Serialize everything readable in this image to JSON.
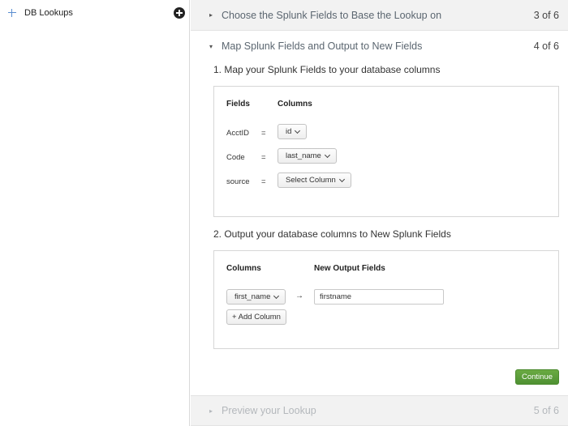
{
  "sidebar": {
    "item_label": "DB Lookups"
  },
  "steps": [
    {
      "title": "Choose the Splunk Fields to Base the Lookup on",
      "count": "3 of 6",
      "caret": "▸"
    },
    {
      "title": "Map Splunk Fields and Output to New Fields",
      "count": "4 of 6",
      "caret": "▾"
    },
    {
      "title": "Preview your Lookup",
      "count": "5 of 6",
      "caret": "▸"
    }
  ],
  "section1": {
    "heading": "1. Map your Splunk Fields to your database columns",
    "fields_header": "Fields",
    "columns_header": "Columns",
    "rows": [
      {
        "field": "AcctID",
        "equals": "=",
        "column": "id"
      },
      {
        "field": "Code",
        "equals": "=",
        "column": "last_name"
      },
      {
        "field": "source",
        "equals": "=",
        "column": "Select Column"
      }
    ]
  },
  "section2": {
    "heading": "2. Output your database columns to New Splunk Fields",
    "columns_header": "Columns",
    "new_fields_header": "New Output Fields",
    "column_value": "first_name",
    "arrow": "→",
    "output_value": "firstname",
    "add_column_label": "+ Add Column"
  },
  "continue_label": "Continue",
  "colors": {
    "primary_green": "#5a9c3a",
    "accent_blue": "#5a8dd0"
  }
}
